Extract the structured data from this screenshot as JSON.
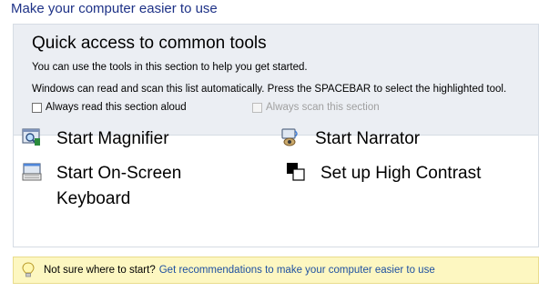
{
  "page": {
    "heading": "Make your computer easier to use"
  },
  "quick_access": {
    "title": "Quick access to common tools",
    "description_1": "You can use the tools in this section to help you get started.",
    "description_2": "Windows can read and scan this list automatically.  Press the SPACEBAR to select the highlighted tool.",
    "read_aloud": {
      "label": "Always read this section aloud",
      "checked": false
    },
    "scan": {
      "label": "Always scan this section",
      "checked": false,
      "enabled": false
    }
  },
  "tools": {
    "magnifier": {
      "label": "Start Magnifier",
      "icon": "magnifier-icon"
    },
    "narrator": {
      "label": "Start Narrator",
      "icon": "narrator-icon"
    },
    "on_screen_keyboard": {
      "label": "Start On-Screen Keyboard",
      "icon": "keyboard-icon"
    },
    "high_contrast": {
      "label": "Set up High Contrast",
      "icon": "contrast-icon"
    }
  },
  "tip": {
    "text": "Not sure where to start?",
    "link": "Get recommendations to make your computer easier to use",
    "icon": "lightbulb-icon"
  },
  "colors": {
    "heading": "#1e3287",
    "link": "#1e50a0",
    "panel_top": "#ebeef3",
    "tip_background": "#fdf7c1"
  }
}
